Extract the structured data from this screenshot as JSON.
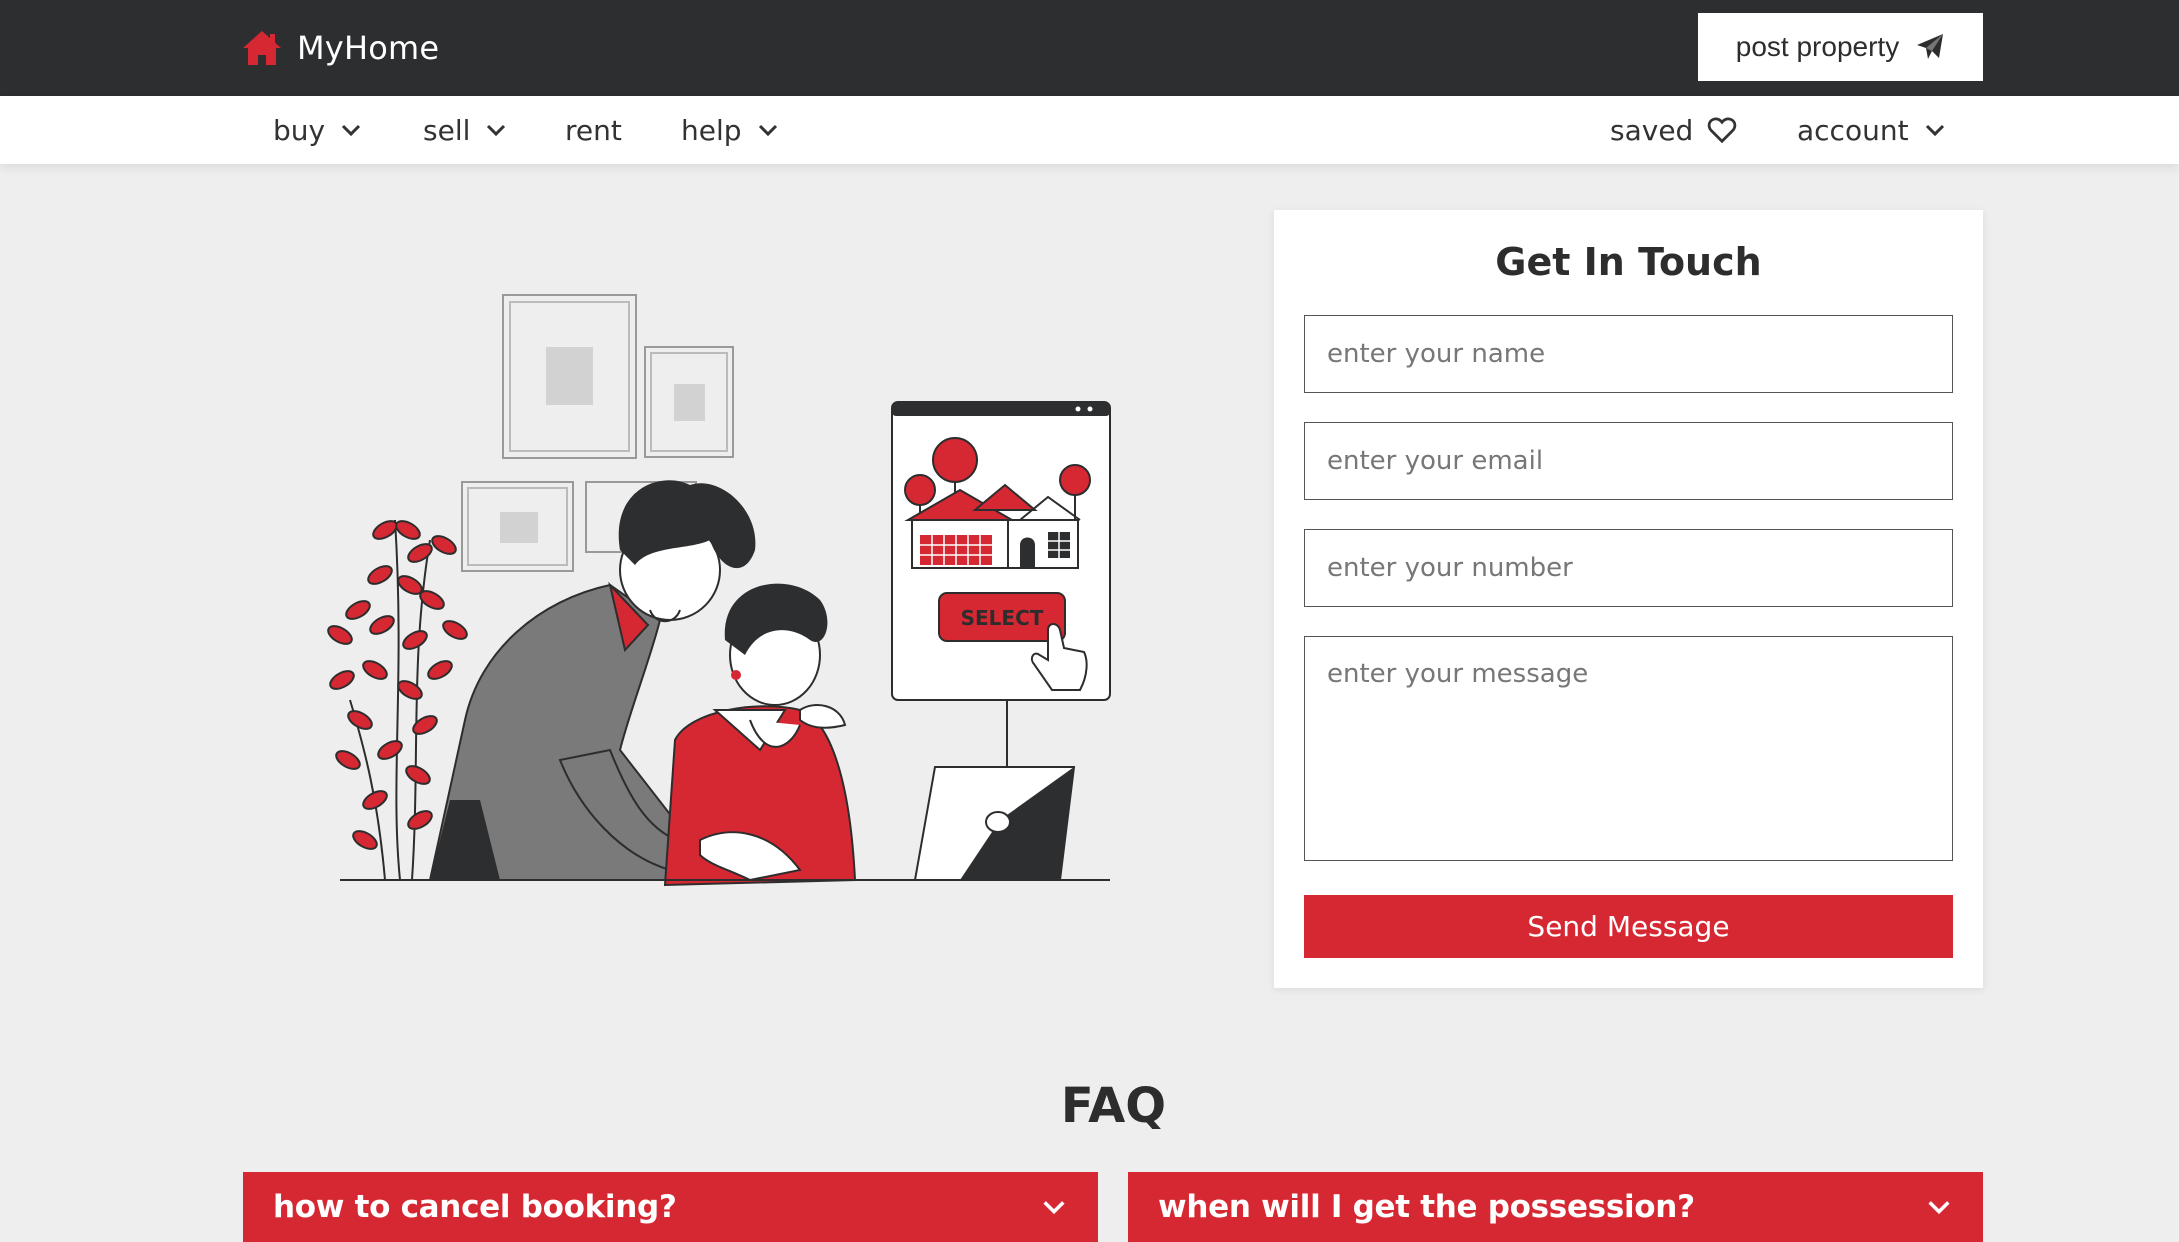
{
  "brand": {
    "name": "MyHome",
    "icon": "home-icon",
    "accent": "#d62832"
  },
  "header": {
    "post_label": "post property",
    "post_icon": "paper-plane-icon"
  },
  "nav": {
    "left": [
      {
        "label": "buy",
        "has_dropdown": true
      },
      {
        "label": "sell",
        "has_dropdown": true
      },
      {
        "label": "rent",
        "has_dropdown": false
      },
      {
        "label": "help",
        "has_dropdown": true
      }
    ],
    "right": [
      {
        "label": "saved",
        "icon": "heart-icon"
      },
      {
        "label": "account",
        "has_dropdown": true
      }
    ]
  },
  "illustration": {
    "select_label": "SELECT"
  },
  "contact": {
    "title": "Get In Touch",
    "name_placeholder": "enter your name",
    "email_placeholder": "enter your email",
    "number_placeholder": "enter your number",
    "message_placeholder": "enter your message",
    "send_label": "Send Message"
  },
  "faq": {
    "title": "FAQ",
    "items": [
      {
        "question": "how to cancel booking?"
      },
      {
        "question": "when will I get the possession?"
      }
    ]
  }
}
